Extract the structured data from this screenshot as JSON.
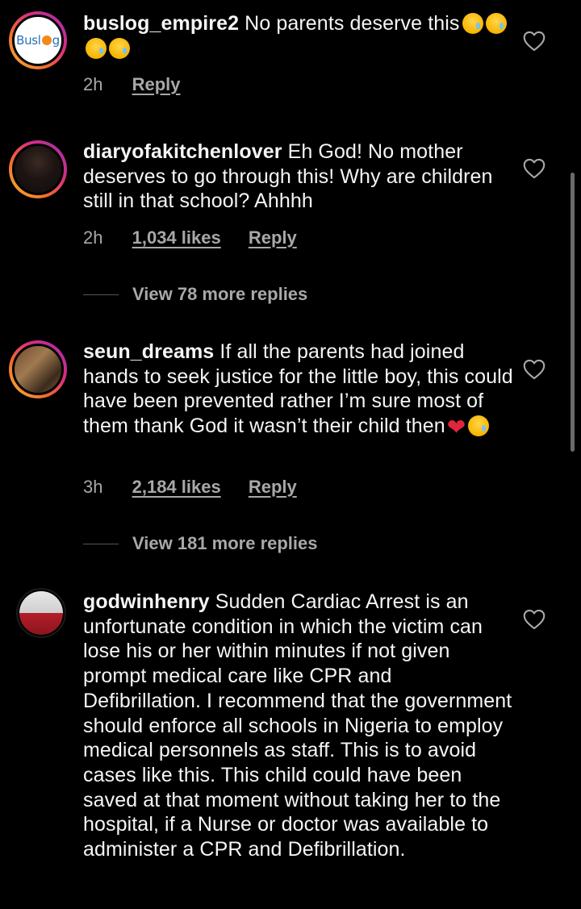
{
  "comments": [
    {
      "username": "buslog_empire2",
      "text": "No parents deserve this",
      "emoji": [
        "crying-face-emoji",
        "crying-face-emoji",
        "crying-face-emoji",
        "crying-face-emoji"
      ],
      "time": "2h",
      "likes": "",
      "reply_label": "Reply",
      "avatar_text": "Buslog"
    },
    {
      "username": "diaryofakitchenlover",
      "text": "Eh God! No mother deserves to go through this! Why are children still in that school? Ahhhh",
      "time": "2h",
      "likes": "1,034 likes",
      "reply_label": "Reply",
      "view_replies": "View 78 more replies"
    },
    {
      "username": "seun_dreams",
      "text": "If all the parents had joined hands to seek justice for the little boy, this could have been prevented rather I’m sure most of them thank God it wasn’t their child then",
      "emoji": [
        "broken-heart-emoji",
        "loudly-crying-face-emoji"
      ],
      "time": "3h",
      "likes": "2,184 likes",
      "reply_label": "Reply",
      "view_replies": "View 181 more replies"
    },
    {
      "username": "godwinhenry",
      "text": "Sudden Cardiac Arrest is an unfortunate condition in which the victim can lose his or her within minutes if not given prompt medical care like CPR and Defibrillation. I recommend that the government should enforce all schools in Nigeria to employ medical personnels as staff. This is to avoid cases like this. This child could have been saved at that moment without taking her to the hospital, if a Nurse or doctor was available to administer a CPR and Defibrillation."
    }
  ],
  "icons": {
    "like": "heart-outline-icon"
  },
  "colors": {
    "background": "#000000",
    "text": "#f5f5f5",
    "secondary": "#a8a8a8",
    "story_ring_start": "#f7b733",
    "story_ring_end": "#9b2fb5",
    "heart_emoji": "#e0263c"
  }
}
